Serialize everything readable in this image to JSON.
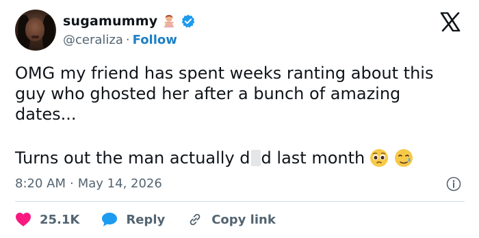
{
  "author": {
    "display_name": "sugamummy",
    "handle": "@ceraliza",
    "separator": "·",
    "follow_label": "Follow"
  },
  "tweet": {
    "text_line1": "OMG my friend has spent weeks ranting about this guy who ghosted her after a bunch of amazing dates...",
    "text_line2_start": "Turns out the man actually d",
    "text_line2_end": "d last month",
    "time": "8:20 AM",
    "date": "May 14, 2026"
  },
  "actions": {
    "likes": "25.1K",
    "reply_label": "Reply",
    "copy_label": "Copy link"
  },
  "icons": {
    "name_emoji": "person-gesturing-no-icon",
    "verified": "verified-badge-icon",
    "brand": "x-logo-icon",
    "info": "info-icon",
    "like": "heart-icon",
    "reply": "reply-bubble-icon",
    "copy": "link-icon",
    "emoji1": "pleading-face-icon",
    "emoji2": "sad-but-relieved-face-icon"
  },
  "colors": {
    "text": "#0f1419",
    "muted": "#536471",
    "link": "#1d7fc4",
    "verified": "#1d9bf0",
    "like": "#f91880",
    "divider": "#cfd9de"
  }
}
